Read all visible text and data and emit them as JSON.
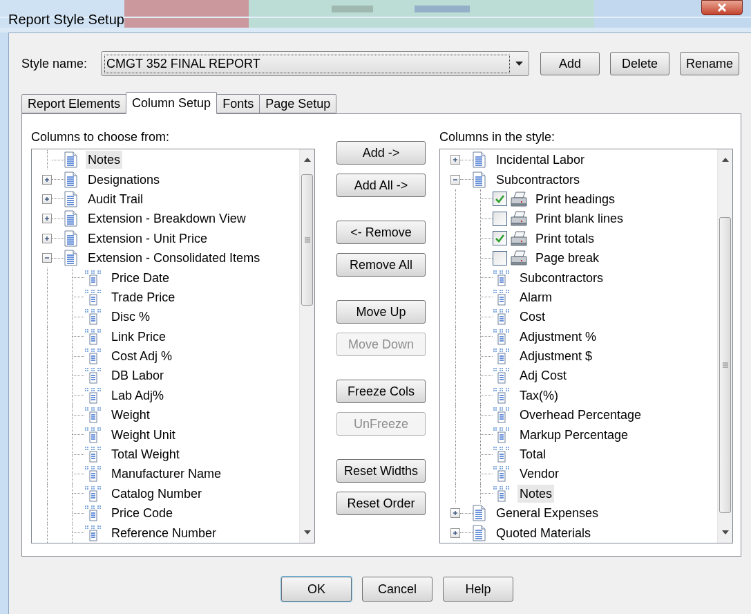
{
  "window": {
    "title": "Report Style Setup"
  },
  "style_name": {
    "label": "Style name:",
    "value": "CMGT 352 FINAL REPORT"
  },
  "style_buttons": [
    "Add",
    "Delete",
    "Rename"
  ],
  "tabs": [
    {
      "label": "Report Elements",
      "selected": false
    },
    {
      "label": "Column Setup",
      "selected": true
    },
    {
      "label": "Fonts",
      "selected": false
    },
    {
      "label": "Page Setup",
      "selected": false
    }
  ],
  "available": {
    "label": "Columns to choose from:",
    "items": [
      {
        "kind": "document",
        "label": "Notes",
        "selected": true
      },
      {
        "kind": "document",
        "label": "Designations",
        "expanded": false,
        "selected": false
      },
      {
        "kind": "document",
        "label": "Audit Trail",
        "expanded": false,
        "selected": false
      },
      {
        "kind": "document",
        "label": "Extension - Breakdown View",
        "expanded": false,
        "selected": false
      },
      {
        "kind": "document",
        "label": "Extension - Unit Price",
        "expanded": false,
        "selected": false
      },
      {
        "kind": "document",
        "label": "Extension - Consolidated Items",
        "expanded": true,
        "selected": false,
        "children": [
          {
            "kind": "column",
            "label": "Price Date",
            "selected": false
          },
          {
            "kind": "column",
            "label": "Trade Price",
            "selected": false
          },
          {
            "kind": "column",
            "label": "Disc %",
            "selected": false
          },
          {
            "kind": "column",
            "label": "Link Price",
            "selected": false
          },
          {
            "kind": "column",
            "label": "Cost Adj %",
            "selected": false
          },
          {
            "kind": "column",
            "label": "DB Labor",
            "selected": false
          },
          {
            "kind": "column",
            "label": "Lab Adj%",
            "selected": false
          },
          {
            "kind": "column",
            "label": "Weight",
            "selected": false
          },
          {
            "kind": "column",
            "label": "Weight Unit",
            "selected": false
          },
          {
            "kind": "column",
            "label": "Total Weight",
            "selected": false
          },
          {
            "kind": "column",
            "label": "Manufacturer Name",
            "selected": false
          },
          {
            "kind": "column",
            "label": "Catalog Number",
            "selected": false
          },
          {
            "kind": "column",
            "label": "Price Code",
            "selected": false
          },
          {
            "kind": "column",
            "label": "Reference Number",
            "selected": false
          }
        ]
      }
    ]
  },
  "action_groups": [
    {
      "buttons": [
        {
          "label": "Add ->",
          "disabled": false
        },
        {
          "label": "Add All ->",
          "disabled": false
        }
      ]
    },
    {
      "buttons": [
        {
          "label": "<- Remove",
          "disabled": false
        },
        {
          "label": "Remove All",
          "disabled": false
        }
      ]
    },
    {
      "buttons": [
        {
          "label": "Move Up",
          "disabled": false
        },
        {
          "label": "Move Down",
          "disabled": true
        }
      ]
    },
    {
      "buttons": [
        {
          "label": "Freeze Cols",
          "disabled": false
        },
        {
          "label": "UnFreeze",
          "disabled": true
        }
      ]
    },
    {
      "buttons": [
        {
          "label": "Reset Widths",
          "disabled": false
        },
        {
          "label": "Reset Order",
          "disabled": false
        }
      ]
    }
  ],
  "chosen": {
    "label": "Columns in the style:",
    "items": [
      {
        "kind": "document",
        "label": "Incidental Labor",
        "expanded": false,
        "selected": false
      },
      {
        "kind": "document",
        "label": "Subcontractors",
        "expanded": true,
        "selected": false,
        "children": [
          {
            "kind": "option",
            "label": "Print headings",
            "checked": true,
            "selected": false
          },
          {
            "kind": "option",
            "label": "Print blank lines",
            "checked": false,
            "selected": false
          },
          {
            "kind": "option",
            "label": "Print totals",
            "checked": true,
            "selected": false
          },
          {
            "kind": "option",
            "label": "Page break",
            "checked": false,
            "selected": false
          },
          {
            "kind": "column",
            "label": "Subcontractors",
            "selected": false
          },
          {
            "kind": "column",
            "label": "Alarm",
            "selected": false
          },
          {
            "kind": "column",
            "label": "Cost",
            "selected": false
          },
          {
            "kind": "column",
            "label": "Adjustment %",
            "selected": false
          },
          {
            "kind": "column",
            "label": "Adjustment $",
            "selected": false
          },
          {
            "kind": "column",
            "label": "Adj Cost",
            "selected": false
          },
          {
            "kind": "column",
            "label": "Tax(%)",
            "selected": false
          },
          {
            "kind": "column",
            "label": "Overhead Percentage",
            "selected": false
          },
          {
            "kind": "column",
            "label": "Markup Percentage",
            "selected": false
          },
          {
            "kind": "column",
            "label": "Total",
            "selected": false
          },
          {
            "kind": "column",
            "label": "Vendor",
            "selected": false
          },
          {
            "kind": "column",
            "label": "Notes",
            "selected": true
          }
        ]
      },
      {
        "kind": "document",
        "label": "General Expenses",
        "expanded": false,
        "selected": false
      },
      {
        "kind": "document",
        "label": "Quoted Materials",
        "expanded": false,
        "selected": false
      }
    ]
  },
  "dialog_buttons": [
    {
      "label": "OK",
      "default": true
    },
    {
      "label": "Cancel",
      "default": false
    },
    {
      "label": "Help",
      "default": false
    }
  ]
}
